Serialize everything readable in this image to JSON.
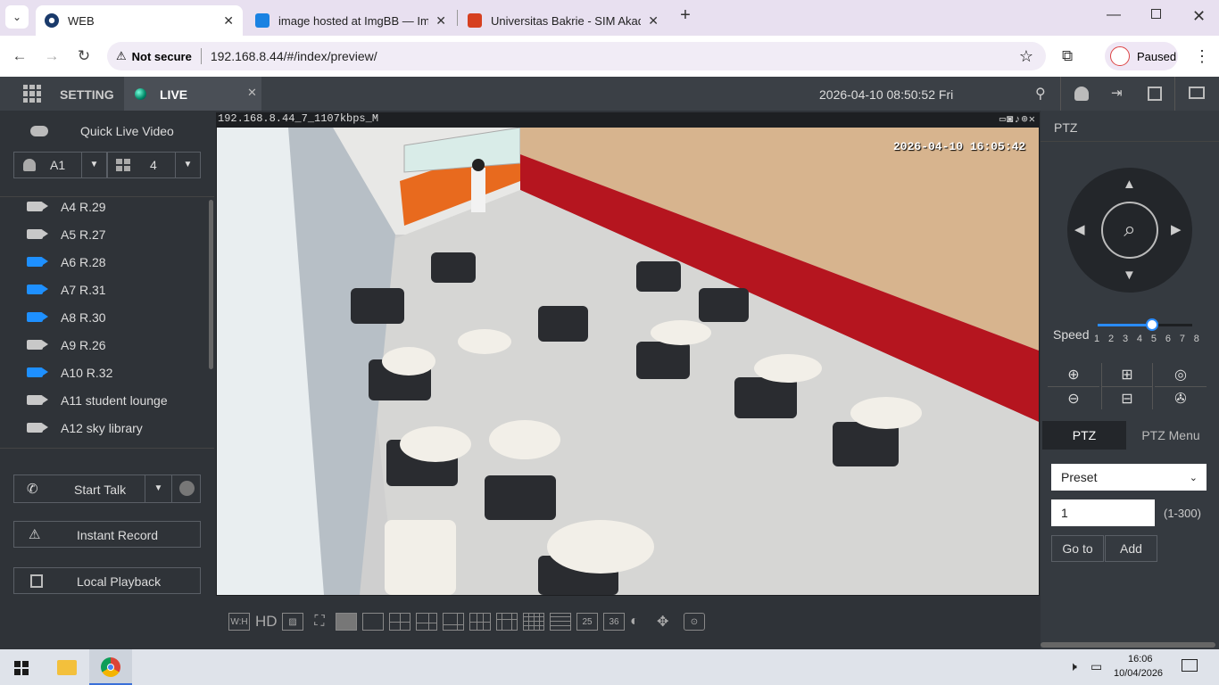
{
  "browser": {
    "tabs": [
      {
        "title": "WEB",
        "favicon_color": "#1a3a6b",
        "close": "✕"
      },
      {
        "title": "image hosted at ImgBB — ImgBB",
        "favicon_color": "#1a82e2",
        "close": "✕"
      },
      {
        "title": "Universitas Bakrie - SIM Akademik",
        "favicon_color": "#d64020",
        "close": "✕"
      }
    ],
    "new_tab": "+",
    "security_label": "Not secure",
    "url": "192.168.8.44/#/index/preview/",
    "profile_status": "Paused"
  },
  "app": {
    "setting_label": "SETTING",
    "live_label": "LIVE",
    "datetime": "2026-04-10 08:50:52 Fri",
    "quick_live": "Quick Live Video",
    "channel_select": "A1",
    "split_select": "4",
    "cameras": [
      {
        "label": "A4 R.29",
        "active": false
      },
      {
        "label": "A5 R.27",
        "active": false
      },
      {
        "label": "A6 R.28",
        "active": true
      },
      {
        "label": "A7 R.31",
        "active": true
      },
      {
        "label": "A8 R.30",
        "active": true
      },
      {
        "label": "A9 R.26",
        "active": false
      },
      {
        "label": "A10 R.32",
        "active": true
      },
      {
        "label": "A11 student lounge",
        "active": false
      },
      {
        "label": "A12 sky library",
        "active": false
      }
    ],
    "start_talk": "Start Talk",
    "instant_record": "Instant Record",
    "local_playback": "Local Playback"
  },
  "video": {
    "stream_label": "192.168.8.44_7_1107kbps_M",
    "osd_time": "2026-04-10 16:05:42"
  },
  "toolbar": {
    "wh": "W:H",
    "hd": "HD",
    "n25": "25",
    "n36": "36"
  },
  "ptz": {
    "title": "PTZ",
    "speed_label": "Speed",
    "speed_ticks": [
      "1",
      "2",
      "3",
      "4",
      "5",
      "6",
      "7",
      "8"
    ],
    "speed_value": 5,
    "tab_ptz": "PTZ",
    "tab_menu": "PTZ Menu",
    "mode": "Preset",
    "preset_value": "1",
    "preset_range": "(1-300)",
    "goto": "Go to",
    "add": "Add"
  },
  "taskbar": {
    "time": "16:06",
    "date": "10/04/2026"
  }
}
